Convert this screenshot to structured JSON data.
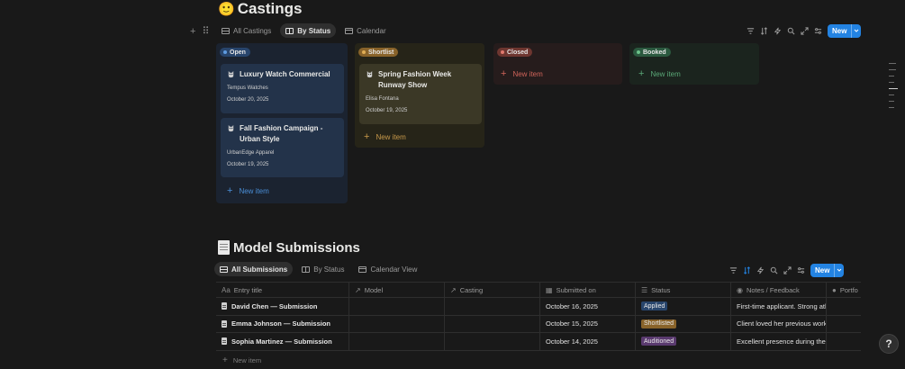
{
  "castings": {
    "emoji": "🙂",
    "title": "Castings",
    "tabs": [
      {
        "label": "All Castings"
      },
      {
        "label": "By Status"
      },
      {
        "label": "Calendar"
      }
    ],
    "new_label": "New",
    "columns": [
      {
        "status": "Open",
        "color": "#28456c",
        "cards": [
          {
            "title": "Luxury Watch Commercial",
            "client": "Tempus Watches",
            "date": "October 20, 2025"
          },
          {
            "title": "Fall Fashion Campaign - Urban Style",
            "client": "UrbanEdge Apparel",
            "date": "October 19, 2025"
          }
        ],
        "new_item": "New item"
      },
      {
        "status": "Shortlist",
        "color": "#89632a",
        "cards": [
          {
            "title": "Spring Fashion Week Runway Show",
            "client": "Elisa Fontana",
            "date": "October 19, 2025"
          }
        ],
        "new_item": "New item"
      },
      {
        "status": "Closed",
        "color": "#6e3630",
        "cards": [],
        "new_item": "New item"
      },
      {
        "status": "Booked",
        "color": "#2b593f",
        "cards": [],
        "new_item": "New item"
      }
    ]
  },
  "submissions": {
    "title": "Model Submissions",
    "tabs": [
      {
        "label": "All Submissions"
      },
      {
        "label": "By Status"
      },
      {
        "label": "Calendar View"
      }
    ],
    "new_label": "New",
    "columns": [
      "Entry title",
      "Model",
      "Casting",
      "Submitted on",
      "Status",
      "Notes / Feedback",
      "Portfo"
    ],
    "rows": [
      {
        "title": "David Chen — Submission",
        "model": "",
        "casting": "",
        "submitted": "October 16, 2025",
        "status": "Applied",
        "notes": "First-time applicant. Strong athl"
      },
      {
        "title": "Emma Johnson — Submission",
        "model": "",
        "casting": "",
        "submitted": "October 15, 2025",
        "status": "Shortlisted",
        "notes": "Client loved her previous work."
      },
      {
        "title": "Sophia Martinez — Submission",
        "model": "",
        "casting": "",
        "submitted": "October 14, 2025",
        "status": "Auditioned",
        "notes": "Excellent presence during the in"
      }
    ],
    "new_item": "New item"
  },
  "colors": {
    "accent": "#2383e2",
    "open": "#28456c",
    "shortlist": "#89632a",
    "closed": "#6e3630",
    "booked": "#2b593f",
    "auditioned": "#5a3a6f"
  },
  "icons": {
    "filter": "filter-icon",
    "sort": "sort-icon",
    "automation": "lightning-icon",
    "search": "search-icon",
    "expand": "expand-icon",
    "settings": "sliders-icon",
    "help": "help-icon"
  }
}
